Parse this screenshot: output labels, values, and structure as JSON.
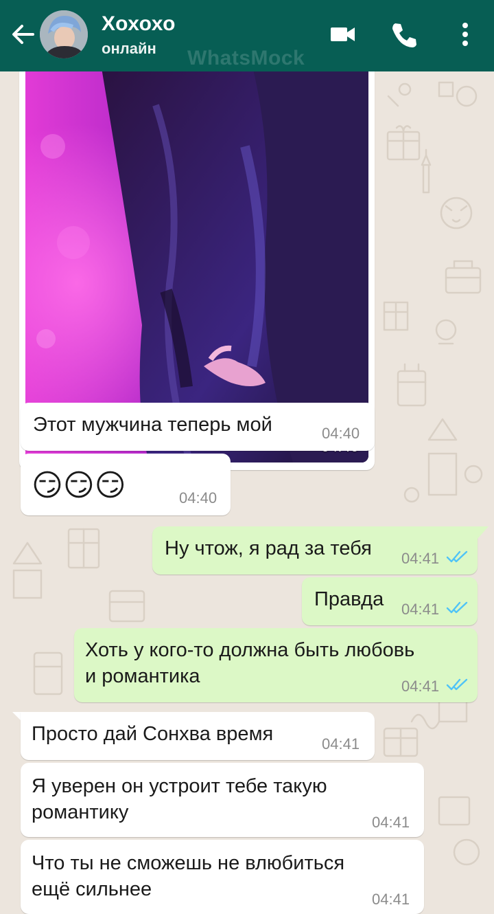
{
  "header": {
    "contact_name": "Хохохо",
    "status": "онлайн",
    "watermark": "WhatsMock"
  },
  "colors": {
    "header_bg": "#075e54",
    "chat_bg": "#ece5dd",
    "incoming_bubble": "#ffffff",
    "outgoing_bubble": "#dcf8c6",
    "read_ticks": "#4fc3f7"
  },
  "icons": [
    "back-arrow-icon",
    "video-call-icon",
    "phone-call-icon",
    "more-options-icon",
    "double-check-icon"
  ],
  "messages": [
    {
      "direction": "in",
      "type": "photo",
      "time": "04:40"
    },
    {
      "direction": "in",
      "text": "Этот мужчина теперь мой",
      "time": "04:40"
    },
    {
      "direction": "in",
      "text": "😏😏😏",
      "time": "04:40"
    },
    {
      "direction": "out",
      "text": "Ну чтож, я рад за тебя",
      "time": "04:41",
      "status": "read"
    },
    {
      "direction": "out",
      "text": "Правда",
      "time": "04:41",
      "status": "read"
    },
    {
      "direction": "out",
      "line1": "Хоть у кого-то должна быть любовь",
      "line2": "и романтика",
      "time": "04:41",
      "status": "read"
    },
    {
      "direction": "in",
      "text": "Просто дай Сонхва время",
      "time": "04:41"
    },
    {
      "direction": "in",
      "line1": "Я уверен он устроит тебе такую",
      "line2": "романтику",
      "time": "04:41"
    },
    {
      "direction": "in",
      "line1": "Что ты не сможешь не влюбиться",
      "line2": "ещё сильнее",
      "time": "04:41"
    }
  ]
}
